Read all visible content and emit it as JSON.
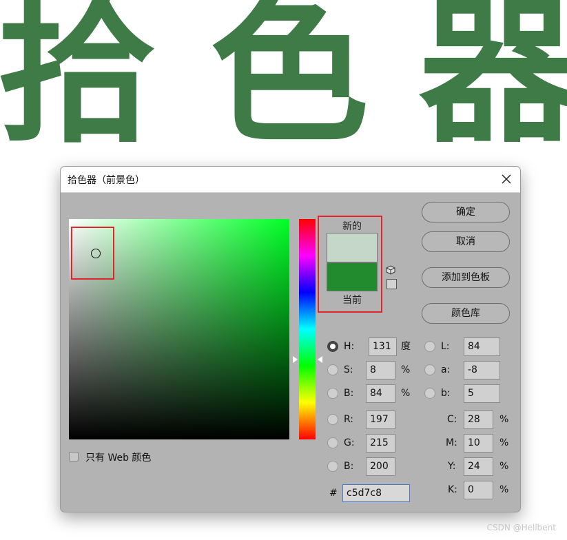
{
  "banner": {
    "chars": [
      "拾",
      "色",
      "器"
    ],
    "color": "#3e7b47"
  },
  "dialog": {
    "title": "拾色器（前景色）",
    "close_icon": "close-icon",
    "buttons": {
      "ok": "确定",
      "cancel": "取消",
      "add_swatch": "添加到色板",
      "color_libraries": "颜色库"
    },
    "preview": {
      "new_label": "新的",
      "current_label": "当前",
      "new_color": "#c5d7c8",
      "current_color": "#228b2d"
    },
    "fields": {
      "H": {
        "label": "H:",
        "value": "131",
        "unit": "度"
      },
      "S": {
        "label": "S:",
        "value": "8",
        "unit": "%"
      },
      "B": {
        "label": "B:",
        "value": "84",
        "unit": "%"
      },
      "R": {
        "label": "R:",
        "value": "197"
      },
      "G": {
        "label": "G:",
        "value": "215"
      },
      "Bb": {
        "label": "B:",
        "value": "200"
      },
      "L": {
        "label": "L:",
        "value": "84"
      },
      "a": {
        "label": "a:",
        "value": "-8"
      },
      "b": {
        "label": "b:",
        "value": "5"
      },
      "C": {
        "label": "C:",
        "value": "28",
        "unit": "%"
      },
      "M": {
        "label": "M:",
        "value": "10",
        "unit": "%"
      },
      "Y": {
        "label": "Y:",
        "value": "24",
        "unit": "%"
      },
      "K": {
        "label": "K:",
        "value": "0",
        "unit": "%"
      }
    },
    "hex": {
      "label": "#",
      "value": "c5d7c8"
    },
    "web_only_label": "只有 Web 颜色",
    "selected_mode": "H"
  },
  "watermark": "CSDN @Hellbent"
}
